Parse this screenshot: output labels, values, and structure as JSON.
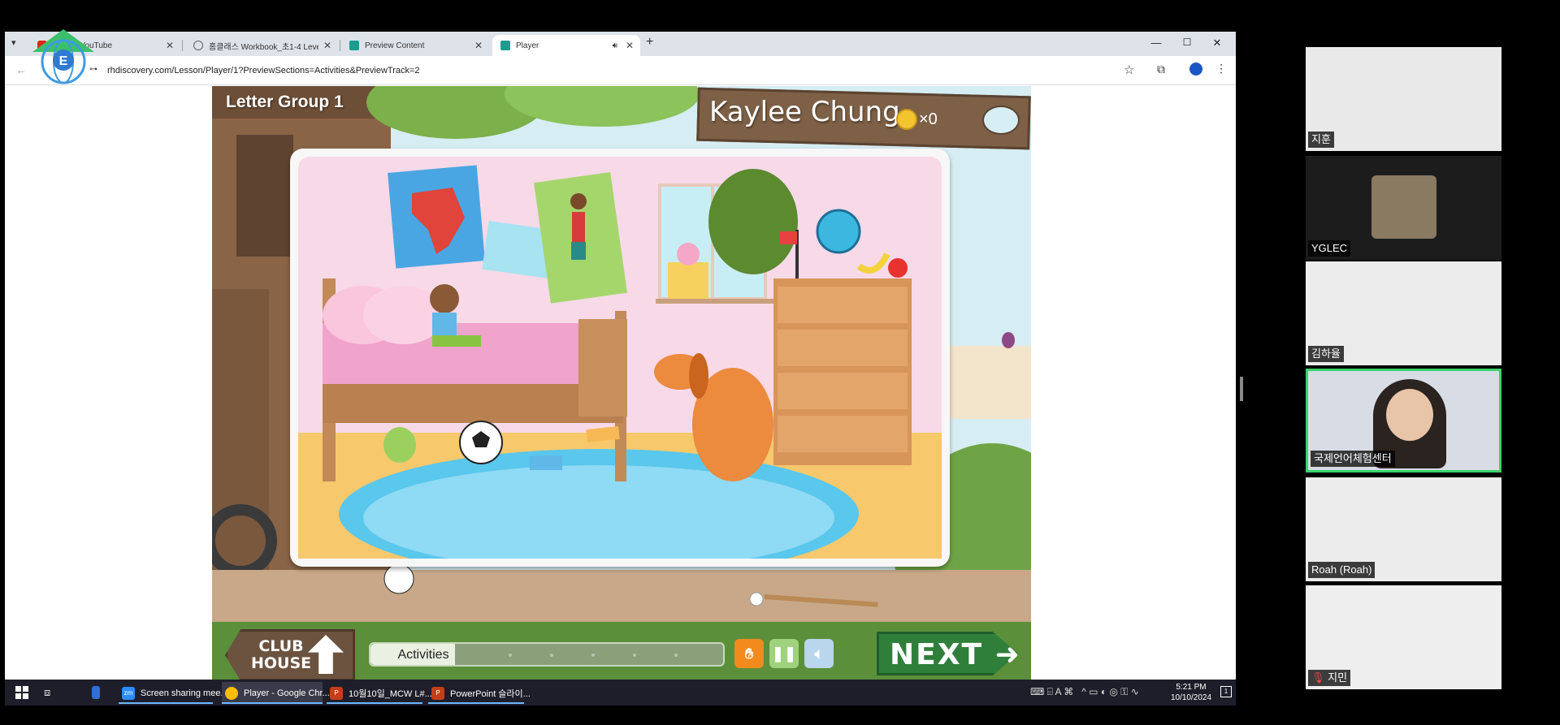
{
  "browser": {
    "tabs": [
      {
        "label": "...ong - YouTube",
        "icon": "youtube-icon",
        "color": "#e62117",
        "active": false
      },
      {
        "label": "홈클래스 Workbook_초1-4 Leve",
        "icon": "globe-icon",
        "color": "#5f6368",
        "active": false
      },
      {
        "label": "Preview Content",
        "icon": "butterfly-icon",
        "color": "#1a9e8f",
        "active": false
      },
      {
        "label": "Player",
        "icon": "butterfly-icon",
        "color": "#1a9e8f",
        "active": true
      }
    ],
    "url": "rhdiscovery.com/Lesson/Player/1?PreviewSections=Activities&PreviewTrack=2"
  },
  "game": {
    "letter_group": "Letter Group 1",
    "player_name": "Kaylee Chung",
    "coin_count": "×0",
    "clubhouse_label_line1": "CLUB",
    "clubhouse_label_line2": "HOUSE",
    "progress_label": "Activities",
    "progress_fraction": 0.24,
    "next_label": "NEXT"
  },
  "taskbar": {
    "items": [
      {
        "label": "Screen sharing mee...",
        "icon": "zoom-icon",
        "color": "#2d8cff",
        "active": false
      },
      {
        "label": "Player - Google Chr...",
        "icon": "chrome-icon",
        "color": "#fbbc04",
        "active": true
      },
      {
        "label": "10월10일_MCW L#...",
        "icon": "powerpoint-icon",
        "color": "#c43e1c",
        "active": false
      },
      {
        "label": "PowerPoint 슬라이...",
        "icon": "powerpoint-icon",
        "color": "#c43e1c",
        "active": false
      }
    ],
    "time": "5:21 PM",
    "date": "10/10/2024"
  },
  "participants": [
    {
      "name": "지훈",
      "bg": "#e9e9e9"
    },
    {
      "name": "YGLEC",
      "bg": "#1c1c1c"
    },
    {
      "name": "김하율",
      "bg": "#ececec"
    },
    {
      "name": "국제언어체험센터",
      "bg": "#d8dce4",
      "active_speaker": true
    },
    {
      "name": "Roah (Roah)",
      "bg": "#ececec"
    },
    {
      "name": "지민",
      "bg": "#eeeeee"
    }
  ],
  "colors": {
    "accent_speaker": "#38d36b",
    "next_green": "#2f7f3b",
    "control_orange": "#f28a1e"
  }
}
